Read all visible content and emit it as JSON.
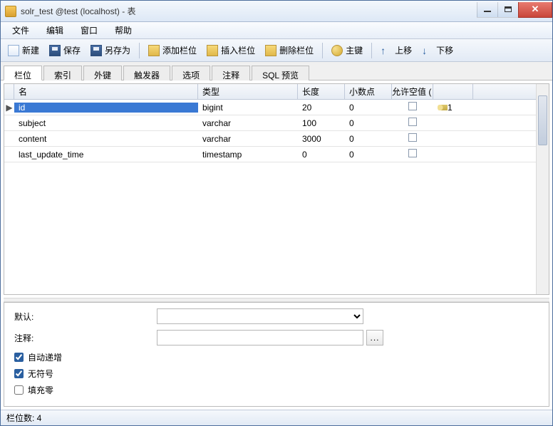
{
  "window": {
    "title": "solr_test @test (localhost) - 表"
  },
  "menu": {
    "file": "文件",
    "edit": "编辑",
    "window": "窗口",
    "help": "帮助"
  },
  "toolbar": {
    "new": "新建",
    "save": "保存",
    "saveas": "另存为",
    "addfield": "添加栏位",
    "insertfield": "插入栏位",
    "delfield": "删除栏位",
    "pk": "主键",
    "up": "上移",
    "down": "下移"
  },
  "tabs": {
    "fields": "栏位",
    "indexes": "索引",
    "fks": "外键",
    "triggers": "触发器",
    "options": "选项",
    "comments": "注释",
    "sql": "SQL 预览"
  },
  "grid": {
    "head": {
      "name": "名",
      "type": "类型",
      "len": "长度",
      "dec": "小数点",
      "null": "允许空值 ("
    },
    "rows": [
      {
        "name": "id",
        "type": "bigint",
        "len": "20",
        "dec": "0",
        "key": "1"
      },
      {
        "name": "subject",
        "type": "varchar",
        "len": "100",
        "dec": "0",
        "key": ""
      },
      {
        "name": "content",
        "type": "varchar",
        "len": "3000",
        "dec": "0",
        "key": ""
      },
      {
        "name": "last_update_time",
        "type": "timestamp",
        "len": "0",
        "dec": "0",
        "key": ""
      }
    ]
  },
  "props": {
    "default_lbl": "默认:",
    "comment_lbl": "注释:",
    "autoinc": "自动递增",
    "unsigned": "无符号",
    "zerofill": "填充零",
    "autoinc_v": true,
    "unsigned_v": true,
    "zerofill_v": false,
    "more": "..."
  },
  "status": {
    "fieldcount": "栏位数: 4"
  }
}
